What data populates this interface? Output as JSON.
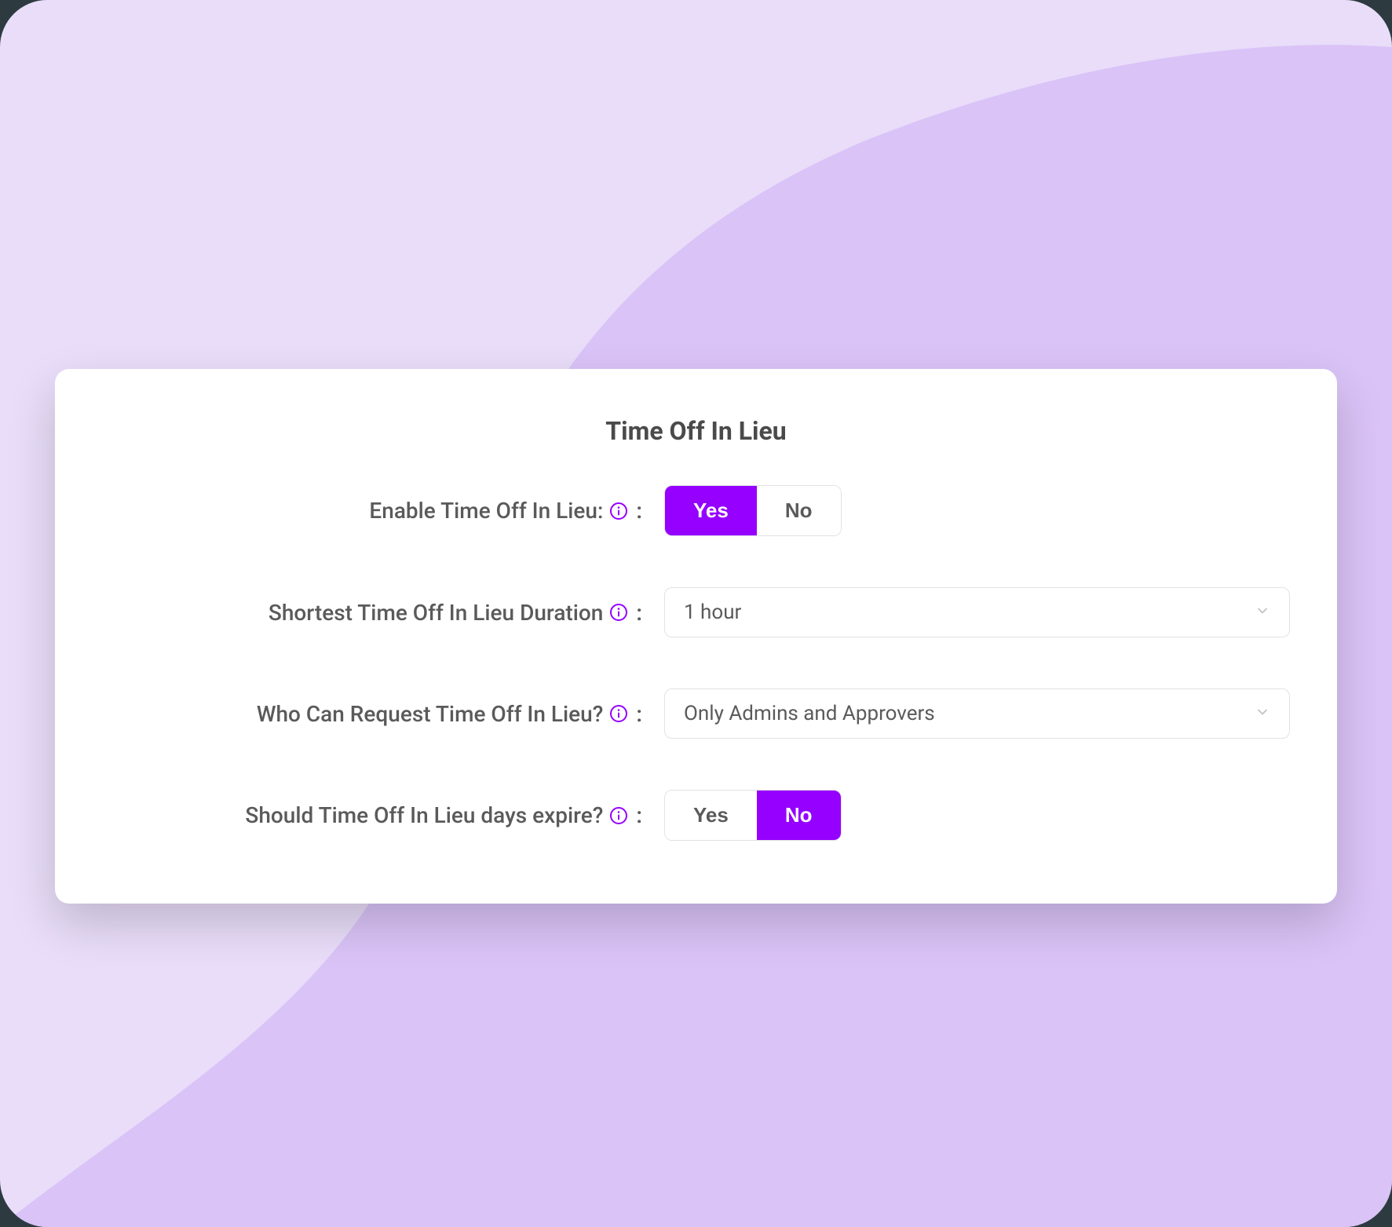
{
  "card": {
    "title": "Time Off In Lieu"
  },
  "fields": {
    "enable": {
      "label": "Enable Time Off In Lieu:",
      "options": {
        "yes": "Yes",
        "no": "No"
      },
      "selected": "yes"
    },
    "duration": {
      "label": "Shortest Time Off In Lieu Duration",
      "value": "1 hour"
    },
    "who": {
      "label": "Who Can Request Time Off In Lieu?",
      "value": "Only Admins and Approvers"
    },
    "expire": {
      "label": "Should Time Off In Lieu days expire?",
      "options": {
        "yes": "Yes",
        "no": "No"
      },
      "selected": "no"
    }
  },
  "colors": {
    "accent": "#9500FF",
    "bg_light": "#E9DDF9",
    "bg_mid": "#DAC3F7"
  }
}
